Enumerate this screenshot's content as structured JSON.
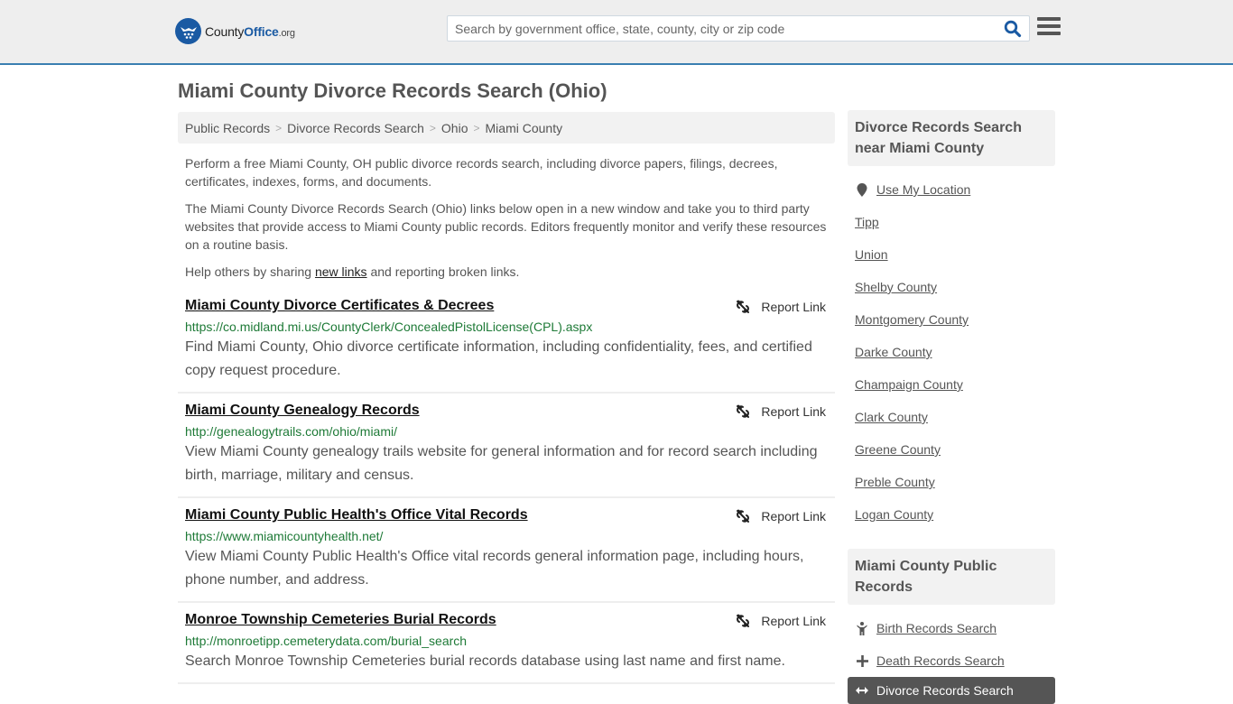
{
  "header": {
    "logo": {
      "name_part1": "County",
      "name_part2": "Office",
      "name_part3": ".org"
    },
    "search": {
      "placeholder": "Search by government office, state, county, city or zip code",
      "value": ""
    },
    "icons": {
      "search": "search-icon",
      "menu": "hamburger-menu-icon"
    },
    "accent_color": "#3a7fb1",
    "brand_color": "#1a5aa3"
  },
  "page": {
    "title": "Miami County Divorce Records Search (Ohio)"
  },
  "breadcrumb": [
    {
      "label": "Public Records"
    },
    {
      "label": "Divorce Records Search"
    },
    {
      "label": "Ohio"
    },
    {
      "label": "Miami County"
    }
  ],
  "breadcrumb_separator": ">",
  "intro": {
    "p1": "Perform a free Miami County, OH public divorce records search, including divorce papers, filings, decrees, certificates, indexes, forms, and documents.",
    "p2": "The Miami County Divorce Records Search (Ohio) links below open in a new window and take you to third party websites that provide access to Miami County public records. Editors frequently monitor and verify these resources on a routine basis.",
    "p3_before": "Help others by sharing ",
    "p3_link": "new links",
    "p3_after": " and reporting broken links."
  },
  "results": [
    {
      "title": "Miami County Divorce Certificates & Decrees",
      "url": "https://co.midland.mi.us/CountyClerk/ConcealedPistolLicense(CPL).aspx",
      "description": "Find Miami County, Ohio divorce certificate information, including confidentiality, fees, and certified copy request procedure.",
      "report_label": "Report Link"
    },
    {
      "title": "Miami County Genealogy Records",
      "url": "http://genealogytrails.com/ohio/miami/",
      "description": "View Miami County genealogy trails website for general information and for record search including birth, marriage, military and census.",
      "report_label": "Report Link"
    },
    {
      "title": "Miami County Public Health's Office Vital Records",
      "url": "https://www.miamicountyhealth.net/",
      "description": "View Miami County Public Health's Office vital records general information page, including hours, phone number, and address.",
      "report_label": "Report Link"
    },
    {
      "title": "Monroe Township Cemeteries Burial Records",
      "url": "http://monroetipp.cemeterydata.com/burial_search",
      "description": "Search Monroe Township Cemeteries burial records database using last name and first name.",
      "report_label": "Report Link"
    }
  ],
  "sidebar": {
    "nearby": {
      "heading": "Divorce Records Search near Miami County",
      "use_location": "Use My Location",
      "items": [
        "Tipp",
        "Union",
        "Shelby County",
        "Montgomery County",
        "Darke County",
        "Champaign County",
        "Clark County",
        "Greene County",
        "Preble County",
        "Logan County"
      ]
    },
    "public_records": {
      "heading": "Miami County Public Records",
      "items": [
        {
          "label": "Birth Records Search",
          "icon": "child-icon"
        },
        {
          "label": "Death Records Search",
          "icon": "plus-icon"
        },
        {
          "label": "Divorce Records Search",
          "icon": "arrows-horizontal-icon",
          "active": true
        }
      ]
    }
  }
}
